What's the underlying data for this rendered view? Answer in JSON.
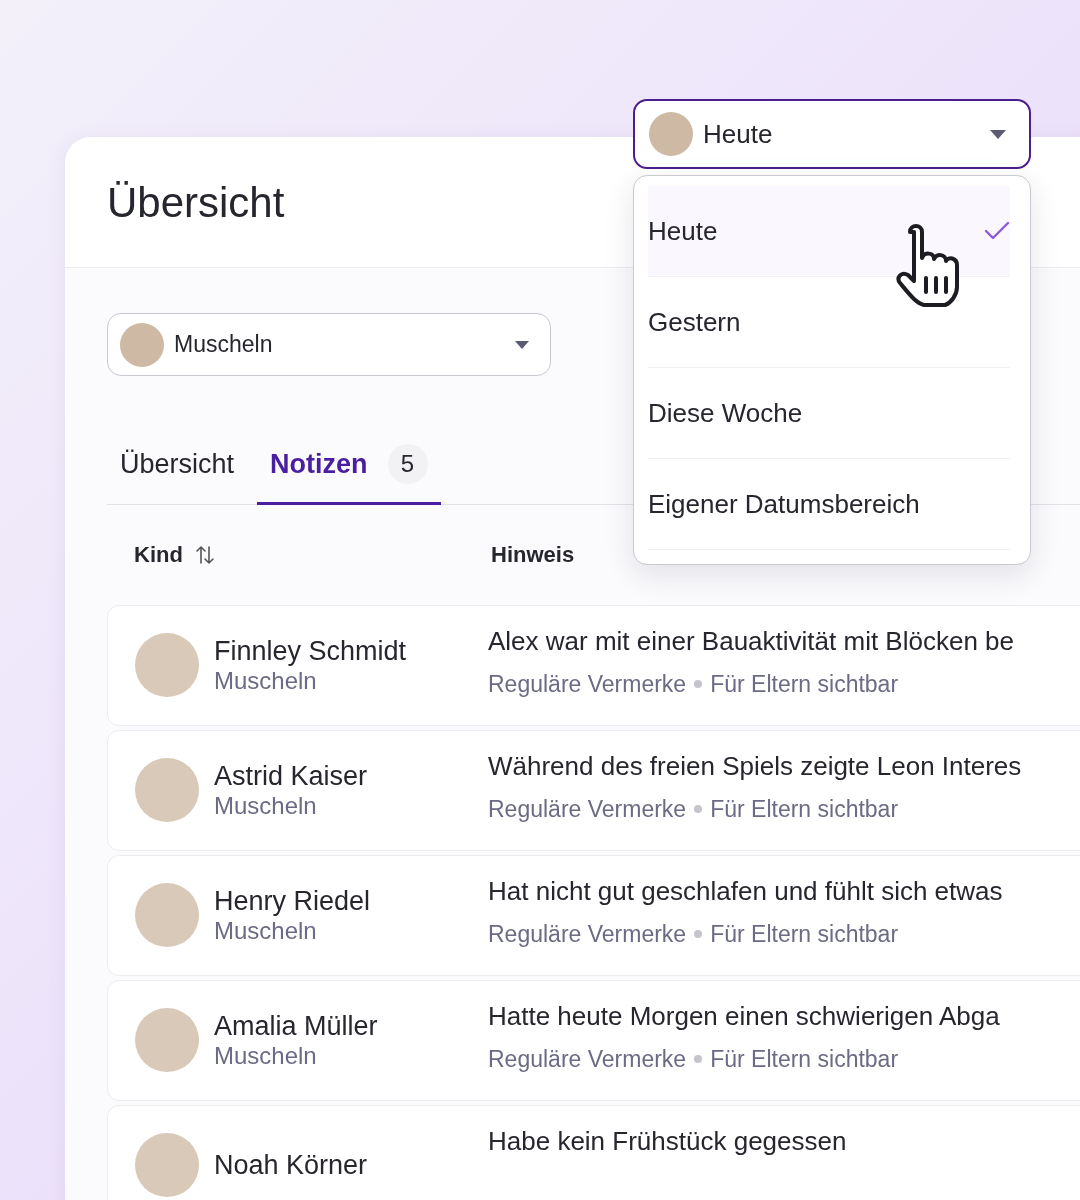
{
  "header": {
    "title": "Übersicht"
  },
  "date_select": {
    "value": "Heute",
    "expanded": true
  },
  "date_menu": {
    "items": [
      {
        "label": "Heute",
        "selected": true
      },
      {
        "label": "Gestern",
        "selected": false
      },
      {
        "label": "Diese Woche",
        "selected": false
      },
      {
        "label": "Eigener Datumsbereich",
        "selected": false
      }
    ]
  },
  "group_select": {
    "value": "Muscheln"
  },
  "tabs": [
    {
      "label": "Übersicht",
      "selected": false
    },
    {
      "label": "Notizen",
      "selected": true,
      "count": "5"
    }
  ],
  "table": {
    "columns": [
      {
        "label": "Kind",
        "sortable": true
      },
      {
        "label": "Hinweis",
        "sortable": false
      }
    ],
    "rows": [
      {
        "name": "Finnley Schmidt",
        "group": "Muscheln",
        "note": "Alex war mit einer Bauaktivität mit Blöcken be",
        "category": "Reguläre Vermerke",
        "visibility": "Für Eltern sichtbar"
      },
      {
        "name": "Astrid Kaiser",
        "group": "Muscheln",
        "note": "Während des freien Spiels zeigte Leon Interes",
        "category": "Reguläre Vermerke",
        "visibility": "Für Eltern sichtbar"
      },
      {
        "name": "Henry Riedel",
        "group": "Muscheln",
        "note": "Hat nicht gut geschlafen und fühlt sich etwas",
        "category": "Reguläre Vermerke",
        "visibility": "Für Eltern sichtbar"
      },
      {
        "name": "Amalia Müller",
        "group": "Muscheln",
        "note": "Hatte heute Morgen einen schwierigen Abga",
        "category": "Reguläre Vermerke",
        "visibility": "Für Eltern sichtbar"
      },
      {
        "name": "Noah Körner",
        "group": "",
        "note": "Habe kein Frühstück gegessen"
      }
    ]
  }
}
